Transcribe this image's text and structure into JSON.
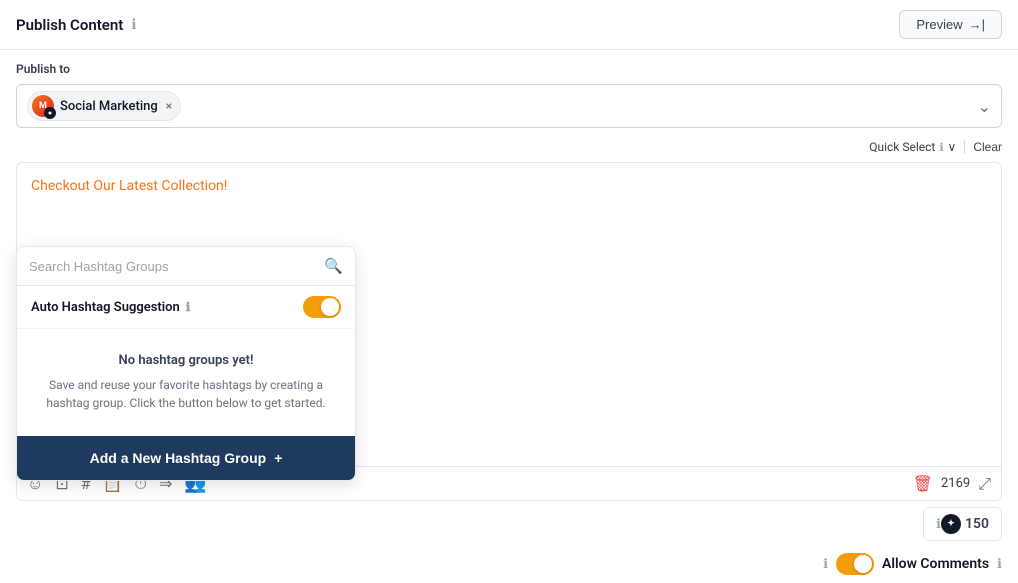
{
  "header": {
    "title": "Publish Content",
    "info_icon": "ℹ",
    "preview_label": "Preview",
    "preview_arrow": "→|"
  },
  "publish_section": {
    "label": "Publish to",
    "selected_account": "Social Marketing",
    "close_icon": "×",
    "chevron": "⌄"
  },
  "quick_select": {
    "label": "Quick Select",
    "info_icon": "ℹ",
    "clear_label": "Clear"
  },
  "content_editor": {
    "placeholder_text": "Checkout Our Latest Collection!",
    "char_count": "2169",
    "icons": {
      "emoji": "☺",
      "image": "⊡",
      "hashtag": "#",
      "file": "📄",
      "clock": "⊙",
      "arrow": "⇒",
      "mention": "👥"
    }
  },
  "hashtag_dropdown": {
    "search_placeholder": "Search Hashtag Groups",
    "auto_suggestion_label": "Auto Hashtag Suggestion",
    "no_hashtag_title": "No hashtag groups yet!",
    "no_hashtag_desc": "Save and reuse your favorite hashtags by creating a hashtag group. Click the button below to get started.",
    "add_btn_label": "Add a New Hashtag Group",
    "add_btn_icon": "+"
  },
  "second_panel": {
    "tiktok_label": "✦",
    "count": "150",
    "allow_comments_label": "Allow Comments",
    "chevron_up": "∧"
  }
}
